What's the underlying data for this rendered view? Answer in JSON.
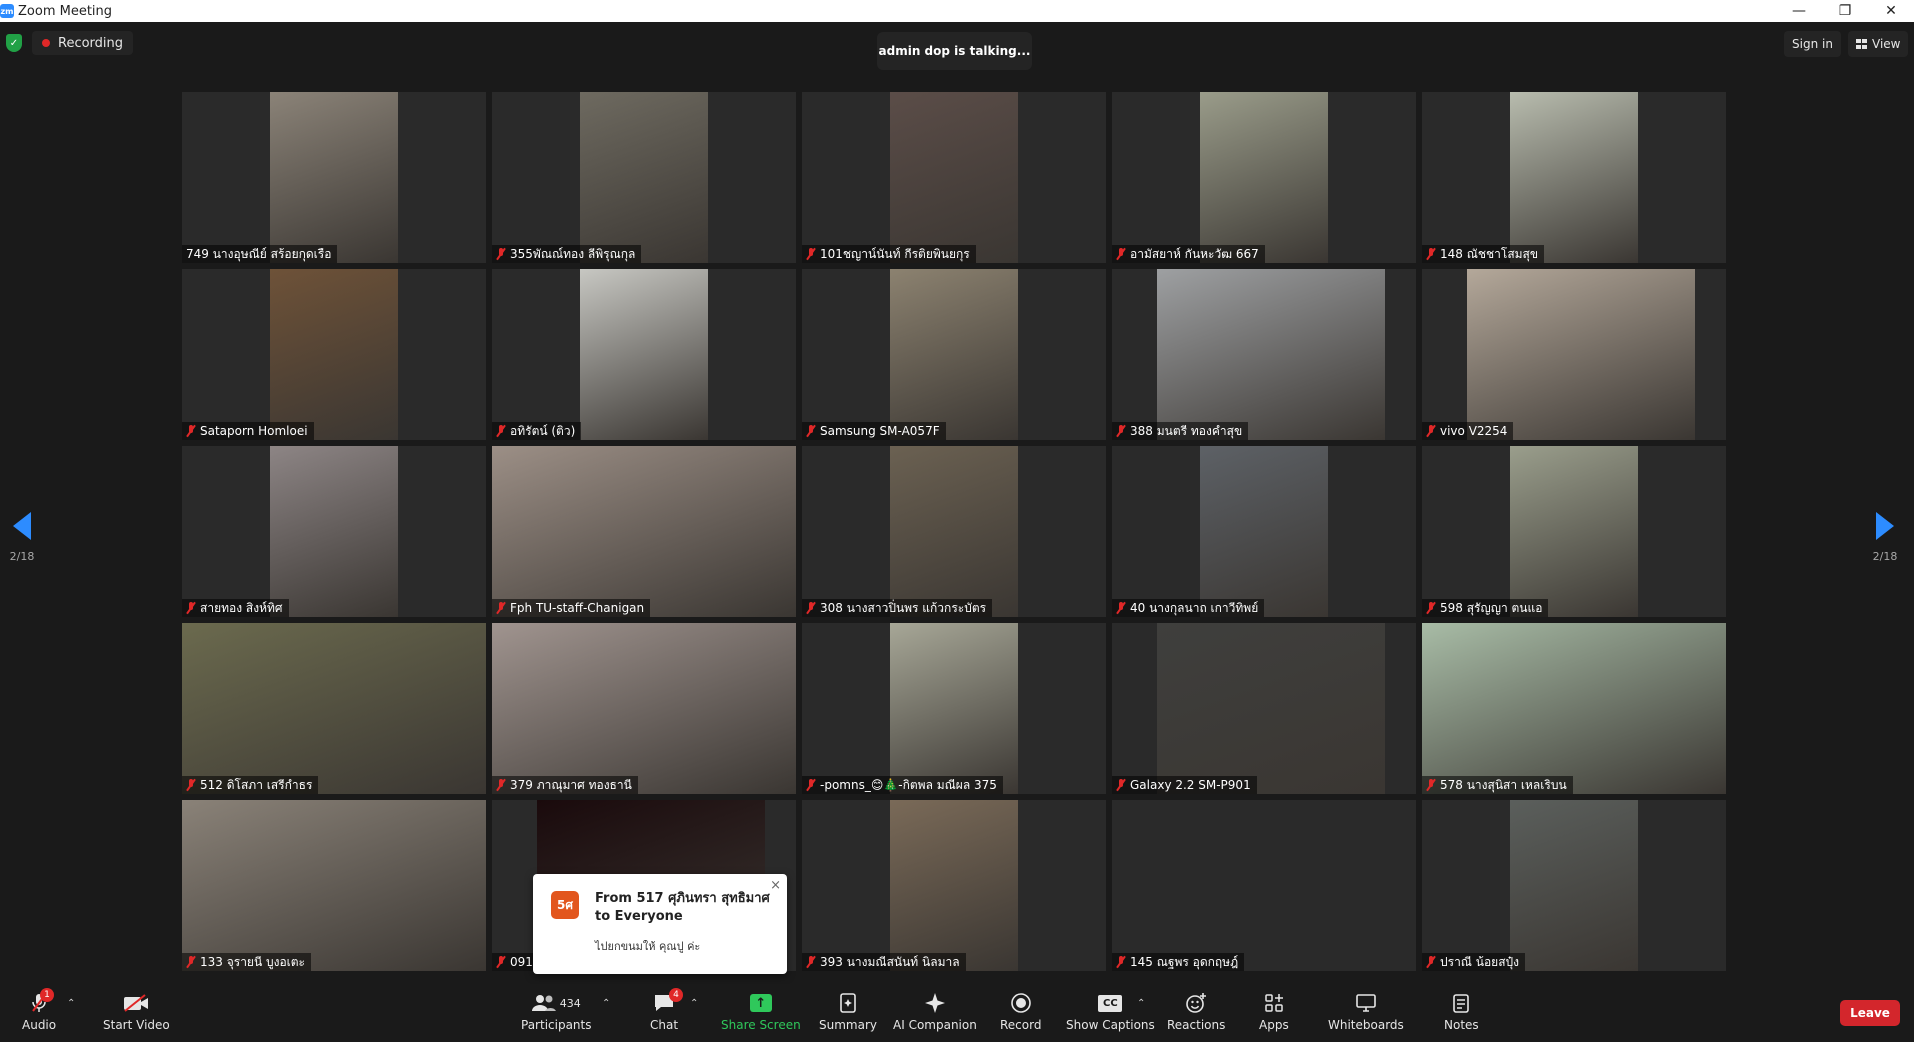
{
  "window": {
    "title": "Zoom Meeting",
    "logo_text": "zm",
    "minimize": "—",
    "restore": "❐",
    "close": "✕"
  },
  "topbar": {
    "recording_label": "Recording",
    "talking": "admin dop is talking...",
    "signin": "Sign in",
    "view": "View"
  },
  "pagination": {
    "left_count": "2/18",
    "right_count": "2/18"
  },
  "tiles": [
    {
      "name": "749 นางอุษณีย์ สร้อยกุดเรือ",
      "feed": "narrow",
      "bg": "#8b8378",
      "muted": false
    },
    {
      "name": "355พัณณ์ทอง ลีพิรุณกุล",
      "feed": "narrow",
      "bg": "#6e6a60",
      "muted": true
    },
    {
      "name": "101ชญาน์นันท์ กีรติยพินยกุร",
      "feed": "narrow",
      "bg": "#5b4d48",
      "muted": true
    },
    {
      "name": "อามัสยาห์ กันหะวัฒ 667",
      "feed": "narrow",
      "bg": "#9a9c8a",
      "muted": true
    },
    {
      "name": "148  ณัชชาโสมสุข",
      "feed": "narrow",
      "bg": "#b8bcae",
      "muted": true
    },
    {
      "name": "Sataporn Homloei",
      "feed": "narrow",
      "bg": "#6e5238",
      "muted": true
    },
    {
      "name": "อทิรัตน์ (ติว)",
      "feed": "narrow",
      "bg": "#c7c7c2",
      "muted": true
    },
    {
      "name": "Samsung SM-A057F",
      "feed": "narrow",
      "bg": "#8c8270",
      "muted": true
    },
    {
      "name": "388 มนตรี ทองคำสุข",
      "feed": "med",
      "bg": "#9ea0a2",
      "muted": true
    },
    {
      "name": "vivo V2254",
      "feed": "med",
      "bg": "#b4a89a",
      "muted": true
    },
    {
      "name": "สายทอง  สิงห์ทิศ",
      "feed": "narrow",
      "bg": "#8d8585",
      "muted": true
    },
    {
      "name": "Fph TU-staff-Chanigan",
      "feed": "wide",
      "bg": "#9c8f86",
      "muted": true
    },
    {
      "name": "308 นางสาวปิ่นพร แก้วกระบัตร",
      "feed": "narrow",
      "bg": "#6b6152",
      "muted": true
    },
    {
      "name": "40 นางกุลนาถ เกาวีทิพย์",
      "feed": "narrow",
      "bg": "#5d6166",
      "muted": true
    },
    {
      "name": "598 สุรัญญา ตนแอ",
      "feed": "narrow",
      "bg": "#9a9e8c",
      "muted": true
    },
    {
      "name": "512 ดิโสภา เสรีกำธร",
      "feed": "wide",
      "bg": "#6b6a4e",
      "muted": true
    },
    {
      "name": "379 ภาณุมาศ ทองธานี",
      "feed": "wide",
      "bg": "#a0948f",
      "muted": true
    },
    {
      "name": "-pomns_😊🎄-กิตพล มณีผล 375",
      "feed": "narrow",
      "bg": "#a7a797",
      "muted": true
    },
    {
      "name": "Galaxy 2.2 SM-P901",
      "feed": "med",
      "bg": "#3f3f3d",
      "muted": true
    },
    {
      "name": "578 นางสุนิสา เหลเริบน",
      "feed": "wide",
      "bg": "#a8bca6",
      "muted": true
    },
    {
      "name": "133 จุรายนี บูงอเตะ",
      "feed": "wide",
      "bg": "#8a8278",
      "muted": true
    },
    {
      "name": "091",
      "feed": "med",
      "bg": "#1a0a0c",
      "muted": true
    },
    {
      "name": "393 นางมณีสนันท์ นิลมาล",
      "feed": "narrow",
      "bg": "#7a6a58",
      "muted": true
    },
    {
      "name": "145 ณฐพร อุดกฤษฎ์",
      "feed": "blank",
      "bg": "#2a2a2a",
      "muted": true
    },
    {
      "name": "ปราณี น้อยสปุ๋ง",
      "feed": "narrow",
      "bg": "#5b5f5c",
      "muted": true
    }
  ],
  "chat_popup": {
    "avatar": "5ศ",
    "from": "From 517  ศุภินทรา  สุทธิมาศ to Everyone",
    "message": "ไปยกขนมให้ คุณปู ค่ะ",
    "close": "×"
  },
  "toolbar": {
    "audio": {
      "label": "Audio",
      "badge": "1",
      "icon": "microphone-icon"
    },
    "video": {
      "label": "Start Video",
      "icon": "video-off-icon"
    },
    "participants": {
      "label": "Participants",
      "count": "434",
      "icon": "participants-icon"
    },
    "chat": {
      "label": "Chat",
      "badge": "4",
      "icon": "chat-icon"
    },
    "share": {
      "label": "Share Screen",
      "icon": "share-screen-icon"
    },
    "summary": {
      "label": "Summary",
      "icon": "summary-icon"
    },
    "ai": {
      "label": "AI Companion",
      "icon": "sparkle-icon"
    },
    "record": {
      "label": "Record",
      "icon": "record-icon"
    },
    "captions": {
      "label": "Show Captions",
      "icon_text": "CC"
    },
    "reactions": {
      "label": "Reactions",
      "icon": "reactions-icon"
    },
    "apps": {
      "label": "Apps",
      "icon": "apps-icon"
    },
    "whiteboards": {
      "label": "Whiteboards",
      "icon": "whiteboard-icon"
    },
    "notes": {
      "label": "Notes",
      "icon": "notes-icon"
    },
    "leave": "Leave"
  },
  "colors": {
    "accent": "#2d8cff",
    "leave": "#d3262c",
    "share": "#2fc85b",
    "recording_dot": "#e02828"
  }
}
